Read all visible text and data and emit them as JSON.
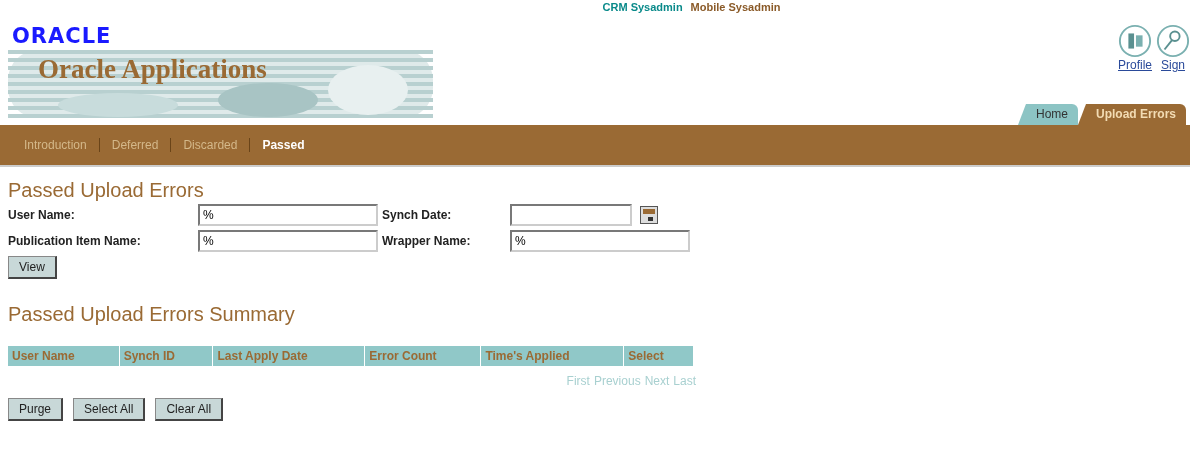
{
  "header": {
    "logo": "ORACLE",
    "app_title": "Oracle Applications",
    "users": [
      "CRM Sysadmin",
      "Mobile Sysadmin"
    ],
    "global_links": [
      "Profile",
      "Sign"
    ],
    "tabs": [
      {
        "label": "Home",
        "selected": false
      },
      {
        "label": "Upload Errors",
        "selected": true
      }
    ]
  },
  "subtabs": [
    {
      "label": "Introduction",
      "selected": false
    },
    {
      "label": "Deferred",
      "selected": false
    },
    {
      "label": "Discarded",
      "selected": false
    },
    {
      "label": "Passed",
      "selected": true
    }
  ],
  "search": {
    "title": "Passed Upload Errors",
    "fields": [
      {
        "label": "User Name:",
        "value": "%",
        "kind": "text"
      },
      {
        "label": "Synch Date:",
        "kind": "date"
      },
      {
        "label": "Publication Item Name:",
        "value": "%",
        "kind": "text"
      },
      {
        "label": "Wrapper Name:",
        "value": "%",
        "kind": "text"
      }
    ],
    "button": "View"
  },
  "summary": {
    "title": "Passed Upload Errors Summary",
    "columns": [
      "User Name",
      "Synch ID",
      "Last Apply Date",
      "Error Count",
      "Time's Applied",
      "Select"
    ],
    "pager": [
      "First",
      "Previous",
      "Next",
      "Last"
    ],
    "buttons": [
      "Purge",
      "Select All",
      "Clear All"
    ]
  }
}
